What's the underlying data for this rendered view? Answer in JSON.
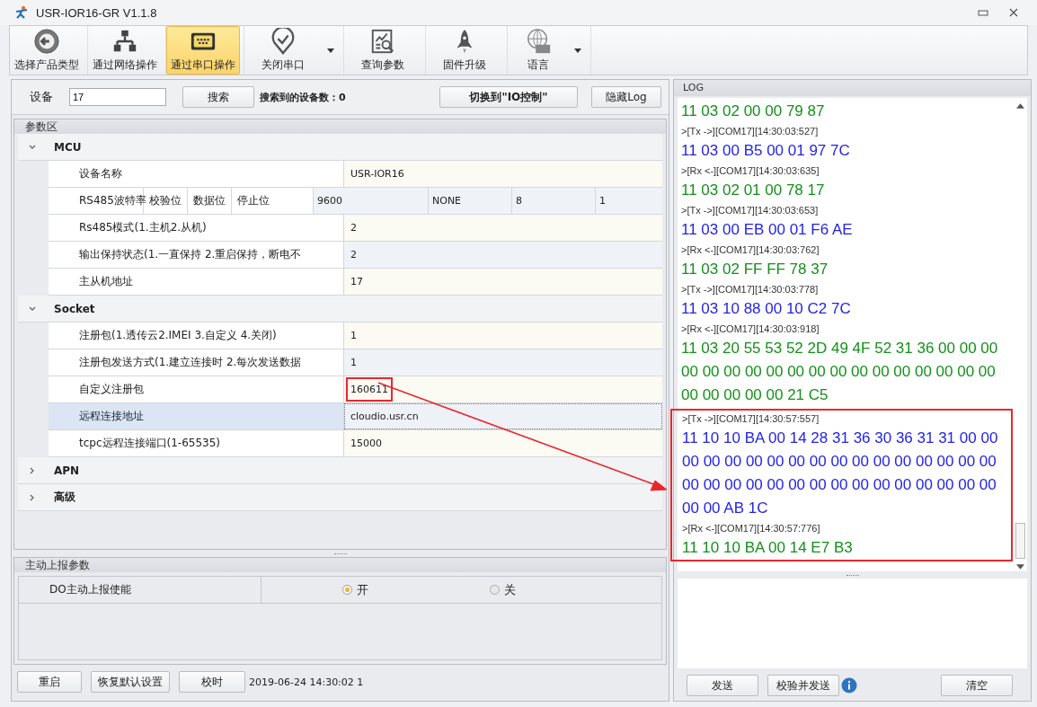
{
  "window": {
    "title": "USR-IOR16-GR V1.1.8"
  },
  "toolbar": [
    {
      "label": "选择产品类型",
      "kind": "back",
      "selected": false,
      "dropdown": false
    },
    {
      "label": "通过网络操作",
      "kind": "network",
      "selected": false,
      "dropdown": false
    },
    {
      "label": "通过串口操作",
      "kind": "serial",
      "selected": true,
      "dropdown": false
    },
    {
      "label": "关闭串口",
      "kind": "pin",
      "selected": false,
      "dropdown": true
    },
    {
      "label": "查询参数",
      "kind": "query",
      "selected": false,
      "dropdown": false
    },
    {
      "label": "固件升级",
      "kind": "rocket",
      "selected": false,
      "dropdown": false
    },
    {
      "label": "语言",
      "kind": "globe",
      "selected": false,
      "dropdown": true
    }
  ],
  "device_bar": {
    "label": "设备",
    "value": "17",
    "search_button": "搜索",
    "found_text": "搜索到的设备数：0",
    "switch_button": "切换到\"IO控制\"",
    "hide_log_button": "隐藏Log"
  },
  "params": {
    "title": "参数区",
    "groups": [
      {
        "title": "MCU",
        "expanded": true,
        "rows": [
          {
            "kind": "single",
            "label": "设备名称",
            "value": "USR-IOR16",
            "selected": false,
            "highlighted": false
          },
          {
            "kind": "multi",
            "labels": [
              "RS485波特率",
              "校验位",
              "数据位",
              "停止位"
            ],
            "values": [
              "9600",
              "NONE",
              "8",
              "1"
            ]
          },
          {
            "kind": "single",
            "label": "Rs485模式(1.主机2.从机)",
            "value": "2",
            "selected": false,
            "highlighted": false
          },
          {
            "kind": "single",
            "label": "输出保持状态(1.一直保持 2.重启保持，断电不",
            "value": "2",
            "selected": false,
            "highlighted": false
          },
          {
            "kind": "single",
            "label": "主从机地址",
            "value": "17",
            "selected": false,
            "highlighted": false
          }
        ]
      },
      {
        "title": "Socket",
        "expanded": true,
        "rows": [
          {
            "kind": "single",
            "label": "注册包(1.透传云2.IMEI 3.自定义 4.关闭)",
            "value": "1",
            "selected": false,
            "highlighted": false
          },
          {
            "kind": "single",
            "label": "注册包发送方式(1.建立连接时 2.每次发送数据",
            "value": "1",
            "selected": false,
            "highlighted": false
          },
          {
            "kind": "single",
            "label": "自定义注册包",
            "value": "160611",
            "selected": false,
            "highlighted": true
          },
          {
            "kind": "single",
            "label": "远程连接地址",
            "value": "cloudio.usr.cn",
            "selected": true,
            "highlighted": false
          },
          {
            "kind": "single",
            "label": "tcpc远程连接端口(1-65535)",
            "value": "15000",
            "selected": false,
            "highlighted": false
          }
        ]
      },
      {
        "title": "APN",
        "expanded": false
      },
      {
        "title": "高级",
        "expanded": false
      }
    ]
  },
  "report": {
    "title": "主动上报参数",
    "label": "DO主动上报使能",
    "options": [
      {
        "label": "开",
        "selected": true
      },
      {
        "label": "关",
        "selected": false
      }
    ]
  },
  "bottom_bar": {
    "buttons": [
      "重启",
      "恢复默认设置",
      "校时"
    ],
    "timestamp": "2019-06-24 14:30:02 1"
  },
  "log": {
    "title": "LOG",
    "entries": [
      {
        "kind": "rx",
        "lines": [
          "11 03 02 00 00 79 87"
        ]
      },
      {
        "kind": "header",
        "lines": [
          ">[Tx ->][COM17][14:30:03:527]"
        ]
      },
      {
        "kind": "tx",
        "lines": [
          "11 03 00 B5 00 01 97 7C"
        ]
      },
      {
        "kind": "header",
        "lines": [
          ">[Rx <-][COM17][14:30:03:635]"
        ]
      },
      {
        "kind": "rx",
        "lines": [
          "11 03 02 01 00 78 17"
        ]
      },
      {
        "kind": "header",
        "lines": [
          ">[Tx ->][COM17][14:30:03:653]"
        ]
      },
      {
        "kind": "tx",
        "lines": [
          "11 03 00 EB 00 01 F6 AE"
        ]
      },
      {
        "kind": "header",
        "lines": [
          ">[Rx <-][COM17][14:30:03:762]"
        ]
      },
      {
        "kind": "rx",
        "lines": [
          "11 03 02 FF FF 78 37"
        ]
      },
      {
        "kind": "header",
        "lines": [
          ">[Tx ->][COM17][14:30:03:778]"
        ]
      },
      {
        "kind": "tx",
        "lines": [
          "11 03 10 88 00 10 C2 7C"
        ]
      },
      {
        "kind": "header",
        "lines": [
          ">[Rx <-][COM17][14:30:03:918]"
        ]
      },
      {
        "kind": "rx",
        "lines": [
          "11 03 20 55 53 52 2D 49 4F 52 31 36 00 00 00",
          "00 00 00 00 00 00 00 00 00 00 00 00 00 00 00",
          "00 00 00 00 00 21 C5"
        ]
      }
    ],
    "highlighted_entries": [
      {
        "kind": "header",
        "lines": [
          ">[Tx ->][COM17][14:30:57:557]"
        ]
      },
      {
        "kind": "tx",
        "lines": [
          "11 10 10 BA 00 14 28 31 36 30 36 31 31 00 00",
          "00 00 00 00 00 00 00 00 00 00 00 00 00 00 00",
          "00 00 00 00 00 00 00 00 00 00 00 00 00 00 00",
          "00 00 AB 1C"
        ]
      },
      {
        "kind": "header",
        "lines": [
          ">[Rx <-][COM17][14:30:57:776]"
        ]
      },
      {
        "kind": "rx",
        "lines": [
          "11 10 10 BA 00 14 E7 B3"
        ]
      }
    ],
    "buttons": [
      "发送",
      "校验并发送",
      "清空"
    ]
  }
}
